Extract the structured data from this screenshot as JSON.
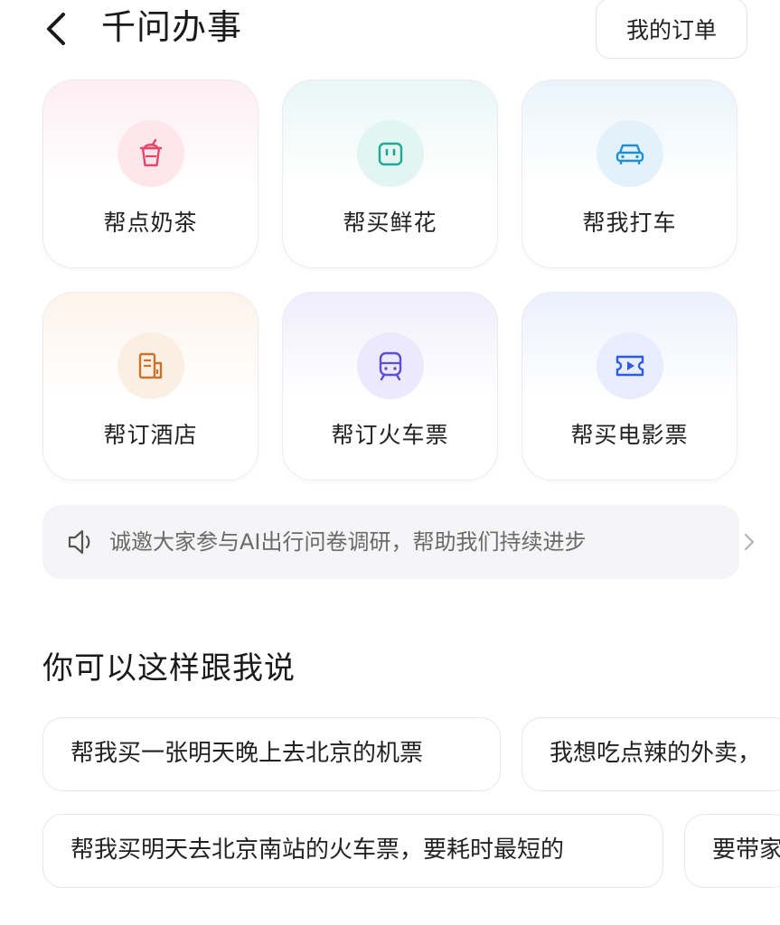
{
  "header": {
    "title": "千问办事",
    "orders_label": "我的订单"
  },
  "services": [
    {
      "label": "帮点奶茶",
      "icon": "milk-tea-cup-icon",
      "color": "#e8456b"
    },
    {
      "label": "帮买鲜花",
      "icon": "flower-box-icon",
      "color": "#1fa89a"
    },
    {
      "label": "帮我打车",
      "icon": "car-icon",
      "color": "#1e8fd6"
    },
    {
      "label": "帮订酒店",
      "icon": "hotel-building-icon",
      "color": "#c9742a"
    },
    {
      "label": "帮订火车票",
      "icon": "train-icon",
      "color": "#5b4fd6"
    },
    {
      "label": "帮买电影票",
      "icon": "movie-ticket-icon",
      "color": "#2f5be0"
    }
  ],
  "notice": {
    "text": "诚邀大家参与AI出行问卷调研，帮助我们持续进步",
    "icon": "speaker-icon"
  },
  "suggestions": {
    "title": "你可以这样跟我说",
    "row1": [
      "帮我买一张明天晚上去北京的机票",
      "我想吃点辣的外卖，"
    ],
    "row2": [
      "帮我买明天去北京南站的火车票，要耗时最短的",
      "要带家"
    ]
  }
}
